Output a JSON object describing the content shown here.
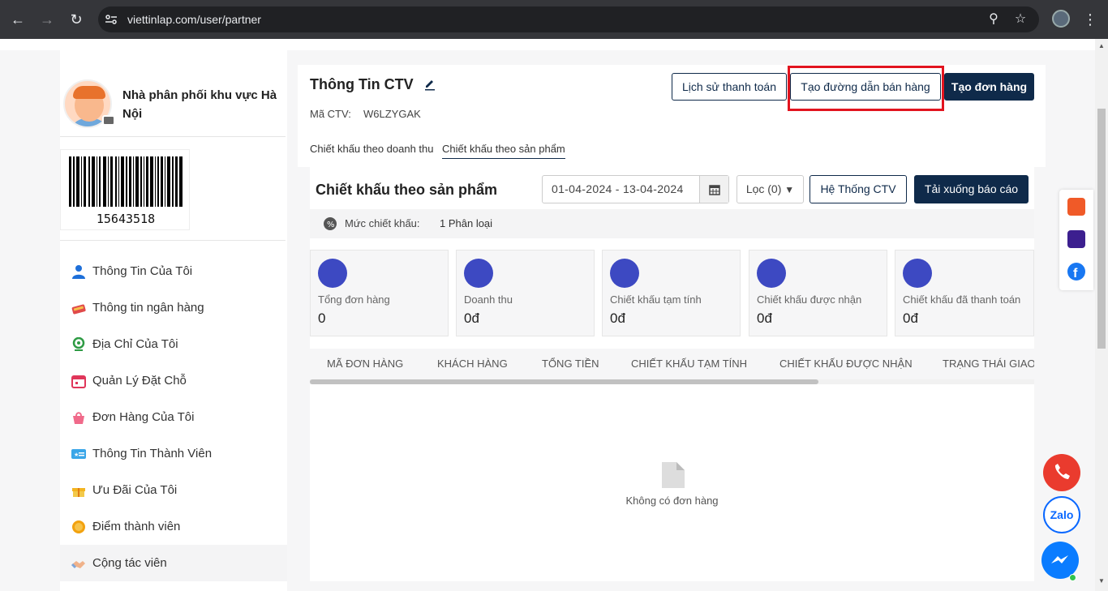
{
  "browser": {
    "url": "viettinlap.com/user/partner"
  },
  "sidebar": {
    "store_name": "Nhà phân phối khu vực Hà Nội",
    "barcode_number": "15643518",
    "menu": [
      {
        "label": "Thông Tin Của Tôi",
        "icon": "user-icon",
        "color": "#1e6fd9"
      },
      {
        "label": "Thông tin ngân hàng",
        "icon": "bank-card-icon",
        "color": "#e04a4a"
      },
      {
        "label": "Địa Chỉ Của Tôi",
        "icon": "location-pin-icon",
        "color": "#2e9b44"
      },
      {
        "label": "Quản Lý Đặt Chỗ",
        "icon": "calendar-icon",
        "color": "#e0365a"
      },
      {
        "label": "Đơn Hàng Của Tôi",
        "icon": "shopping-bag-icon",
        "color": "#f06a8a"
      },
      {
        "label": "Thông Tin Thành Viên",
        "icon": "member-card-icon",
        "color": "#3aa6e8"
      },
      {
        "label": "Ưu Đãi Của Tôi",
        "icon": "gift-icon",
        "color": "#f3b420"
      },
      {
        "label": "Điểm thành viên",
        "icon": "coin-icon",
        "color": "#f2a20f"
      },
      {
        "label": "Cộng tác viên",
        "icon": "handshake-icon",
        "color": "#e8a070"
      }
    ]
  },
  "main": {
    "title": "Thông Tin CTV",
    "code_label": "Mã CTV:",
    "code_value": "W6LZYGAK",
    "buttons": {
      "payment_history": "Lịch sử thanh toán",
      "create_link": "Tạo đường dẫn bán hàng",
      "create_order": "Tạo đơn hàng"
    },
    "subtabs": [
      "Chiết khấu theo doanh thu",
      "Chiết khấu theo sản phẩm"
    ],
    "active_subtab": 1,
    "section_title": "Chiết khấu theo sản phẩm",
    "date_range": "01-04-2024 - 13-04-2024",
    "filter_label": "Lọc (0)",
    "system_button": "Hệ Thống CTV",
    "download_button": "Tải xuống báo cáo",
    "rate_label": "Mức chiết khấu:",
    "rate_value": "1 Phân loại",
    "stats": [
      {
        "label": "Tổng đơn hàng",
        "value": "0",
        "icon": "box-icon"
      },
      {
        "label": "Doanh thu",
        "value": "0đ",
        "icon": "revenue-icon"
      },
      {
        "label": "Chiết khấu tạm tính",
        "value": "0đ",
        "icon": "coins-stack-icon"
      },
      {
        "label": "Chiết khấu được nhận",
        "value": "0đ",
        "icon": "hand-coin-icon"
      },
      {
        "label": "Chiết khấu đã thanh toán",
        "value": "0đ",
        "icon": "cash-icon"
      }
    ],
    "table_headers": [
      "MÃ ĐƠN HÀNG",
      "KHÁCH HÀNG",
      "TỔNG TIỀN",
      "CHIẾT KHẤU TẠM TÍNH",
      "CHIẾT KHẤU ĐƯỢC NHẬN",
      "TRẠNG THÁI GIAO"
    ],
    "empty_text": "Không có đơn hàng"
  },
  "colors": {
    "brand_navy": "#0f2a4a",
    "highlight_red": "#e2141f",
    "stat_icon": "#3d49c2"
  },
  "floating": {
    "zalo_label": "Zalo"
  }
}
